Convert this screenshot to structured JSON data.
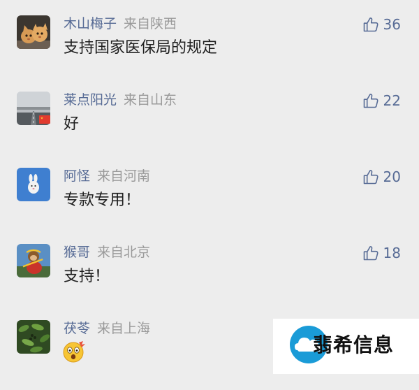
{
  "comments": [
    {
      "username": "木山梅子",
      "location": "来自陕西",
      "text": "支持国家医保局的规定",
      "likes": "36",
      "avatar": "cat-kittens-avatar"
    },
    {
      "username": "莱点阳光",
      "location": "来自山东",
      "text": "好",
      "likes": "22",
      "avatar": "road-landscape-avatar",
      "badge": "china-flag-icon"
    },
    {
      "username": "阿怪",
      "location": "来自河南",
      "text": "专款专用！",
      "likes": "20",
      "avatar": "cartoon-rabbit-avatar"
    },
    {
      "username": "猴哥",
      "location": "来自北京",
      "text": "支持！",
      "likes": "18",
      "avatar": "monkey-king-avatar"
    },
    {
      "username": "茯苓",
      "location": "来自上海",
      "text": "",
      "emoji": "shocked-face-emoji",
      "likes": "",
      "avatar": "green-plants-avatar"
    }
  ],
  "watermark": {
    "text": "翡希信息",
    "logo": "cloud-logo-icon"
  },
  "colors": {
    "background": "#ededed",
    "username": "#576b95",
    "location": "#9a9a9a",
    "text": "#1f1f1f"
  }
}
